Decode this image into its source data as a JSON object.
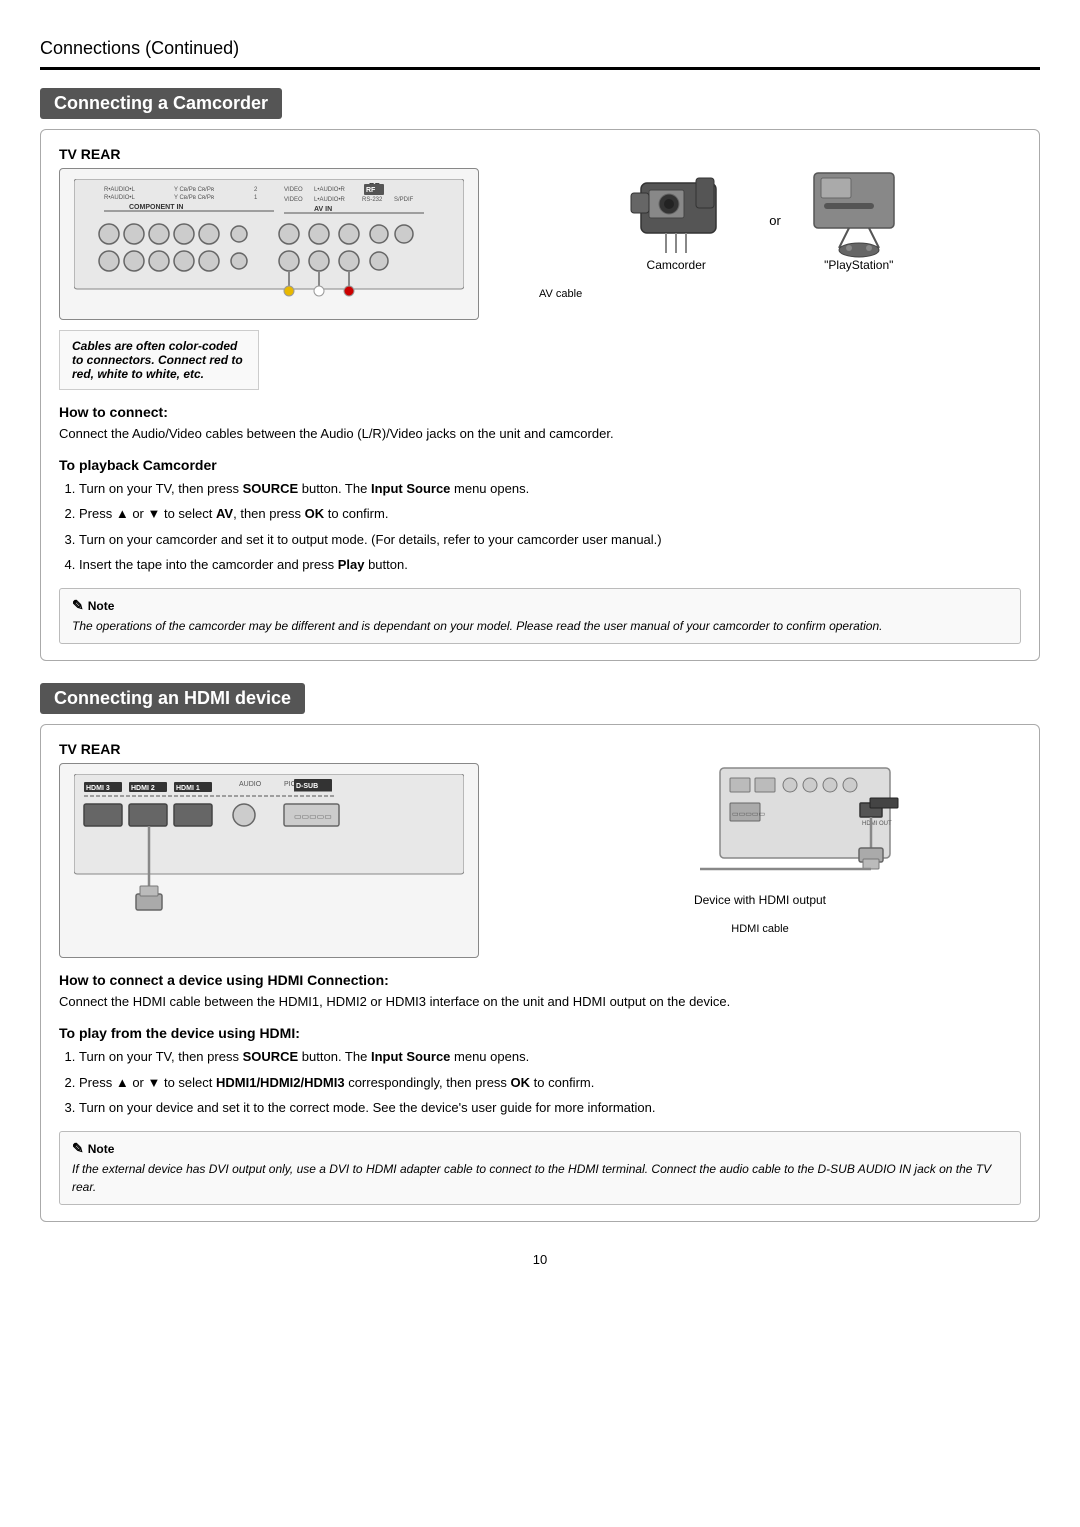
{
  "page": {
    "title": "Connections",
    "title_suffix": " (Continued)",
    "page_number": "10"
  },
  "camcorder_section": {
    "header": "Connecting a Camcorder",
    "tv_rear_label": "TV REAR",
    "note_italic": "Cables are often color-coded to connectors. Connect red to red, white to white, etc.",
    "av_cable_label": "AV cable",
    "playstation_label": "\"PlayStation\"",
    "camcorder_label": "Camcorder",
    "or_text": "or",
    "how_to_connect_heading": "How to connect:",
    "how_to_connect_text": "Connect the Audio/Video cables between the Audio (L/R)/Video jacks on the unit and camcorder.",
    "to_playback_heading": "To playback Camcorder",
    "to_playback_steps": [
      "Turn on your TV,  then press SOURCE button. The Input Source menu opens.",
      "Press ▲ or ▼ to select AV, then press OK to confirm.",
      "Turn on your camcorder and set it to output mode. (For details, refer to your camcorder user manual.)",
      "Insert the tape into the camcorder and press Play button."
    ],
    "note_title": "Note",
    "note_text": "The operations of the camcorder may be different and is dependant on your model. Please read the user manual of your camcorder to confirm operation."
  },
  "hdmi_section": {
    "header": "Connecting an HDMI device",
    "tv_rear_label": "TV REAR",
    "hdmi_cable_label": "HDMI cable",
    "device_label": "Device with HDMI output",
    "how_to_connect_heading": "How to connect a device using HDMI Connection:",
    "how_to_connect_text": "Connect the HDMI cable between the HDMI1, HDMI2 or HDMI3 interface on the unit and HDMI output on the device.",
    "to_play_heading": "To play from the device using HDMI:",
    "to_play_steps": [
      "Turn on your TV,  then press SOURCE button. The Input Source menu opens.",
      "Press ▲ or ▼ to select HDMI1/HDMI2/HDMI3 correspondingly, then press OK to confirm.",
      "Turn on your device and set it to the correct mode. See the device's user guide for more information."
    ],
    "note_title": "Note",
    "note_text": "If the external device has DVI output only, use a DVI to HDMI adapter cable to connect to the HDMI terminal. Connect the audio cable to the D-SUB AUDIO IN jack on the TV rear."
  }
}
